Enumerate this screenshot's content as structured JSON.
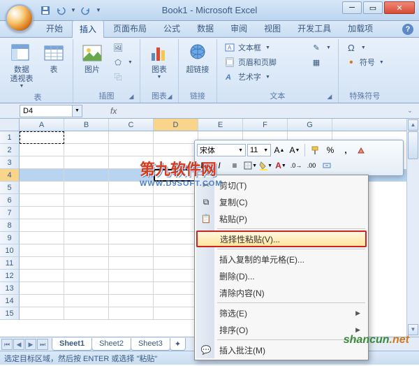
{
  "window": {
    "title": "Book1 - Microsoft Excel"
  },
  "qat": {
    "save": "保存",
    "undo": "撤销",
    "redo": "重做"
  },
  "tabs": [
    "开始",
    "插入",
    "页面布局",
    "公式",
    "数据",
    "审阅",
    "视图",
    "开发工具",
    "加载项"
  ],
  "active_tab_index": 1,
  "ribbon": {
    "groups": [
      {
        "label": "表",
        "buttons": [
          {
            "label": "数据\n透视表",
            "id": "pivot"
          },
          {
            "label": "表",
            "id": "table"
          }
        ]
      },
      {
        "label": "插图",
        "buttons": [
          {
            "label": "图片",
            "id": "picture"
          },
          {
            "label": "剪贴画",
            "id": "clipart"
          },
          {
            "label": "形状",
            "id": "shapes"
          },
          {
            "label": "SmartArt",
            "id": "smartart"
          }
        ],
        "collapsed_after": 1
      },
      {
        "label": "图表",
        "buttons": [
          {
            "label": "图表",
            "id": "chart"
          }
        ]
      },
      {
        "label": "链接",
        "buttons": [
          {
            "label": "超链接",
            "id": "hyperlink"
          }
        ]
      },
      {
        "label": "文本",
        "buttons": [
          {
            "label": "文本框",
            "id": "textbox"
          },
          {
            "label": "页眉和页脚",
            "id": "headerfooter"
          },
          {
            "label": "艺术字",
            "id": "wordart"
          }
        ]
      },
      {
        "label": "特殊符号",
        "buttons": [
          {
            "label": "符号",
            "id": "symbol"
          }
        ]
      }
    ]
  },
  "namebox": "D4",
  "columns": [
    "A",
    "B",
    "C",
    "D",
    "E",
    "F",
    "G"
  ],
  "row_count": 15,
  "selected_row": 4,
  "copied_cell": "A1",
  "sheets": [
    "Sheet1",
    "Sheet2",
    "Sheet3"
  ],
  "active_sheet_index": 0,
  "status_text": "选定目标区域，然后按 ENTER 或选择 \"粘贴\"",
  "mini_toolbar": {
    "font": "宋体",
    "size": "11",
    "buttons_row1": [
      "grow-font",
      "shrink-font",
      "format-painter",
      "percent",
      "comma",
      "clear"
    ],
    "buttons_row2": [
      "bold",
      "italic",
      "center",
      "borders",
      "font-color",
      "fill-color",
      "decrease-decimal",
      "increase-decimal",
      "merge"
    ]
  },
  "context_menu": [
    {
      "label": "剪切(T)",
      "icon": "cut",
      "hl": false
    },
    {
      "label": "复制(C)",
      "icon": "copy",
      "hl": false
    },
    {
      "label": "粘贴(P)",
      "icon": "paste",
      "hl": false
    },
    {
      "sep": true
    },
    {
      "label": "选择性粘贴(V)...",
      "icon": "",
      "hl": true
    },
    {
      "sep": true
    },
    {
      "label": "插入复制的单元格(E)...",
      "icon": "",
      "hl": false
    },
    {
      "label": "删除(D)...",
      "icon": "",
      "hl": false
    },
    {
      "label": "清除内容(N)",
      "icon": "",
      "hl": false
    },
    {
      "sep": true
    },
    {
      "label": "筛选(E)",
      "icon": "",
      "sub": true
    },
    {
      "label": "排序(O)",
      "icon": "",
      "sub": true
    },
    {
      "sep": true
    },
    {
      "label": "插入批注(M)",
      "icon": "comment",
      "hl": false
    }
  ],
  "watermarks": {
    "w1_main": "第九软件网",
    "w1_sub": "WWW.D9SOFT.COM",
    "w2": "shancun",
    "w2_suffix": ".net"
  }
}
